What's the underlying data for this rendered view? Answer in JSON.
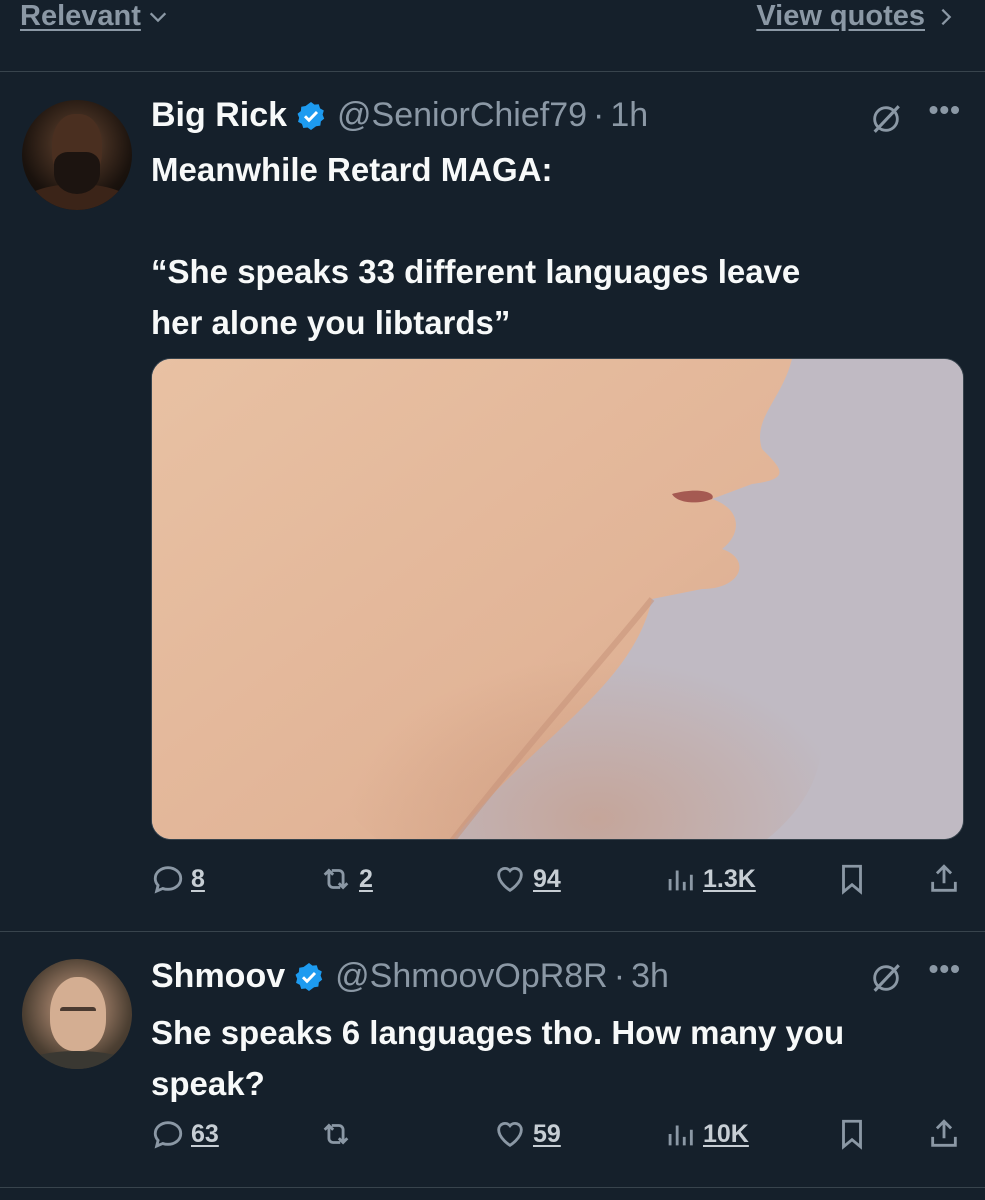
{
  "topbar": {
    "relevant": "Relevant",
    "view_quotes": "View quotes"
  },
  "tweets": [
    {
      "name": "Big Rick",
      "handle": "@SeniorChief79",
      "separator": "·",
      "time": "1h",
      "text_line1": "Meanwhile Retard MAGA:",
      "text_line2": "“She speaks 33 different languages leave",
      "text_line3": "her alone you libtards”",
      "media": "photo-side-profile-chin",
      "replies": "8",
      "reposts": "2",
      "likes": "94",
      "views": "1.3K"
    },
    {
      "name": "Shmoov",
      "handle": "@ShmoovOpR8R",
      "separator": "·",
      "time": "3h",
      "text_line1": "She speaks 6 languages tho.  How many you",
      "text_line2": "speak?",
      "replies": "63",
      "reposts": "",
      "likes": "59",
      "views": "10K"
    }
  ],
  "colors": {
    "background": "#15202b",
    "verified": "#1d9bf0",
    "muted": "#8b98a5"
  },
  "icons": [
    "chevron-down-icon",
    "chevron-right-icon",
    "verified-badge-icon",
    "grok-icon",
    "more-icon",
    "reply-icon",
    "repost-icon",
    "like-icon",
    "views-icon",
    "bookmark-icon",
    "share-icon"
  ]
}
